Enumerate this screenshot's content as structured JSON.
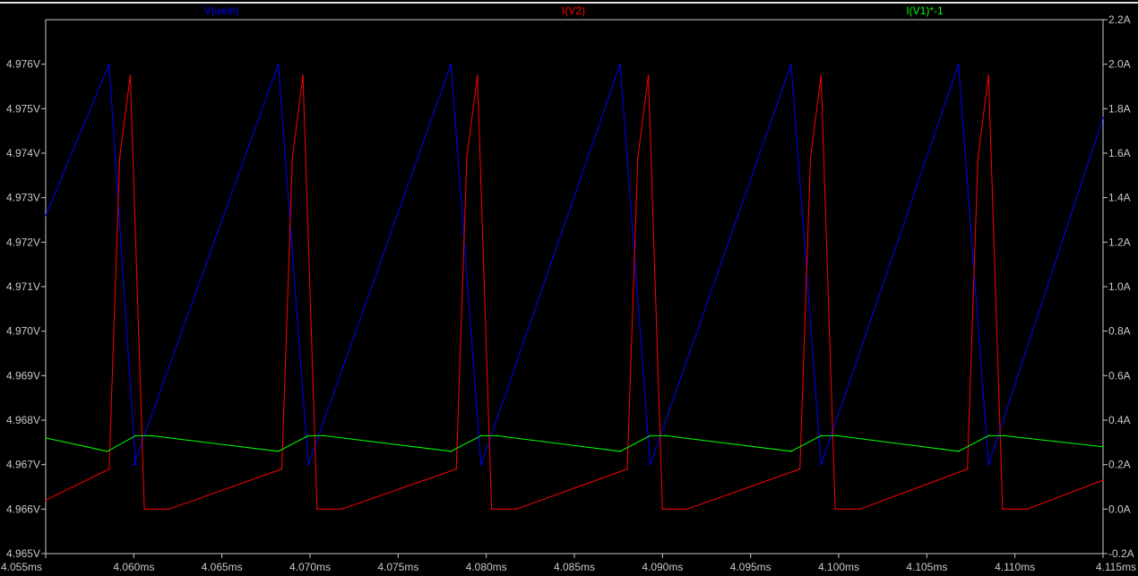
{
  "chart_data": {
    "type": "line",
    "title": "",
    "xlabel": "",
    "ylabel_left": "",
    "ylabel_right": "",
    "xlim": [
      4.055,
      4.115
    ],
    "ylim_left": [
      4.965,
      4.977
    ],
    "ylim_right": [
      -0.2,
      2.2
    ],
    "grid": false,
    "x_ticks": [
      "4.055ms",
      "4.060ms",
      "4.065ms",
      "4.070ms",
      "4.075ms",
      "4.080ms",
      "4.085ms",
      "4.090ms",
      "4.095ms",
      "4.100ms",
      "4.105ms",
      "4.110ms",
      "4.115ms"
    ],
    "y_left_ticks": [
      "4.965V",
      "4.966V",
      "4.967V",
      "4.968V",
      "4.969V",
      "4.970V",
      "4.971V",
      "4.972V",
      "4.973V",
      "4.974V",
      "4.975V",
      "4.976V"
    ],
    "y_right_ticks": [
      "-0.2A",
      "0.0A",
      "0.2A",
      "0.4A",
      "0.6A",
      "0.8A",
      "1.0A",
      "1.2A",
      "1.4A",
      "1.6A",
      "1.8A",
      "2.0A",
      "2.2A"
    ],
    "series": [
      {
        "name": "V(uein)",
        "color": "#0000ff",
        "axis": "left",
        "x": [
          4.055,
          4.0586,
          4.0601,
          4.06,
          4.0682,
          4.0699,
          4.0699,
          4.078,
          4.0797,
          4.0797,
          4.0876,
          4.0893,
          4.0893,
          4.0973,
          4.099,
          4.099,
          4.1068,
          4.1085,
          4.1085,
          4.115
        ],
        "y": [
          4.9726,
          4.976,
          4.967,
          4.967,
          4.976,
          4.967,
          4.967,
          4.976,
          4.967,
          4.967,
          4.976,
          4.967,
          4.967,
          4.976,
          4.967,
          4.967,
          4.976,
          4.967,
          4.967,
          4.9748
        ]
      },
      {
        "name": "I(V2)",
        "color": "#ff0000",
        "axis": "right",
        "x": [
          4.055,
          4.0586,
          4.0592,
          4.0598,
          4.0606,
          4.062,
          4.0684,
          4.069,
          4.0696,
          4.0704,
          4.0718,
          4.0783,
          4.0789,
          4.0795,
          4.0803,
          4.0817,
          4.088,
          4.0886,
          4.0892,
          4.09,
          4.0914,
          4.0978,
          4.0984,
          4.099,
          4.0998,
          4.1012,
          4.1073,
          4.1079,
          4.1085,
          4.1093,
          4.1107,
          4.115
        ],
        "y": [
          0.04,
          0.18,
          1.58,
          1.95,
          0.0,
          0.0,
          0.18,
          1.58,
          1.95,
          0.0,
          0.0,
          0.18,
          1.58,
          1.95,
          0.0,
          0.0,
          0.18,
          1.58,
          1.95,
          0.0,
          0.0,
          0.18,
          1.58,
          1.95,
          0.0,
          0.0,
          0.18,
          1.58,
          1.95,
          0.0,
          0.0,
          0.13
        ]
      },
      {
        "name": "I(V1)*-1",
        "color": "#00ff00",
        "axis": "right",
        "x": [
          4.055,
          4.0585,
          4.0601,
          4.061,
          4.0682,
          4.0699,
          4.0708,
          4.078,
          4.0797,
          4.0806,
          4.0876,
          4.0893,
          4.0902,
          4.0973,
          4.099,
          4.0999,
          4.1068,
          4.1085,
          4.1094,
          4.115
        ],
        "y": [
          0.32,
          0.26,
          0.33,
          0.33,
          0.26,
          0.33,
          0.33,
          0.26,
          0.33,
          0.33,
          0.26,
          0.33,
          0.33,
          0.26,
          0.33,
          0.33,
          0.26,
          0.33,
          0.33,
          0.28
        ]
      }
    ]
  }
}
